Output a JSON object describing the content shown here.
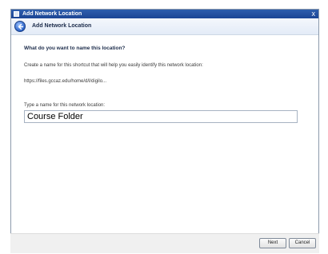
{
  "window": {
    "title": "Add Network Location",
    "close_glyph": "x"
  },
  "header": {
    "back_icon": "back-arrow-icon",
    "title": "Add Network Location"
  },
  "main": {
    "heading": "What do you want to name this location?",
    "description": "Create a name for this shortcut that will help you easily identify this network location:",
    "address": "https://files.gccaz.edu/home/d/l/digilo...",
    "input_label": "Type a name for this network location:",
    "input_value": "Course Folder"
  },
  "footer": {
    "next_label": "Next",
    "cancel_label": "Cancel"
  },
  "colors": {
    "titlebar": "#1c4594",
    "header_bg": "#e3ebf7",
    "content_bg": "#f0f0f0",
    "accent": "#2a62c8"
  }
}
